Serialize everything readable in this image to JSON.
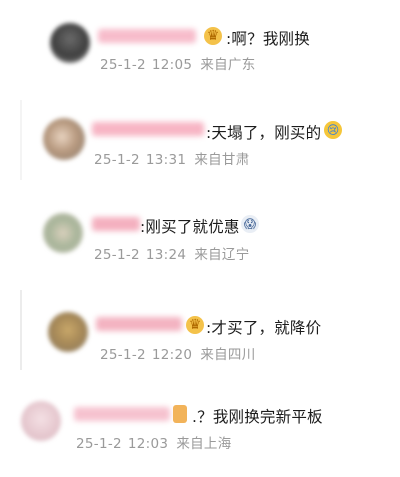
{
  "comments": [
    {
      "text": ":啊？我刚换",
      "date": "25-1-2",
      "time": "12:05",
      "location": "来自广东",
      "emoji": "crown-badge"
    },
    {
      "text": ":天塌了，刚买的",
      "date": "25-1-2",
      "time": "13:31",
      "location": "来自甘肃",
      "emoji": "crying-face"
    },
    {
      "text": ":刚买了就优惠",
      "date": "25-1-2",
      "time": "13:24",
      "location": "来自辽宁",
      "emoji": "anguished-face"
    },
    {
      "text": ":才买了，就降价",
      "date": "25-1-2",
      "time": "12:20",
      "location": "来自四川",
      "emoji": "crown-badge"
    },
    {
      "text": ".？我刚换完新平板",
      "date": "25-1-2",
      "time": "12:03",
      "location": "来自上海",
      "emoji": "tag-badge"
    }
  ],
  "colors": {
    "text": "#1c1c1c",
    "meta": "#9a9a9a",
    "name_blur": "#f6b3c2",
    "emoji_gold": "#f2b231",
    "emoji_blue": "#5ea7e8"
  }
}
